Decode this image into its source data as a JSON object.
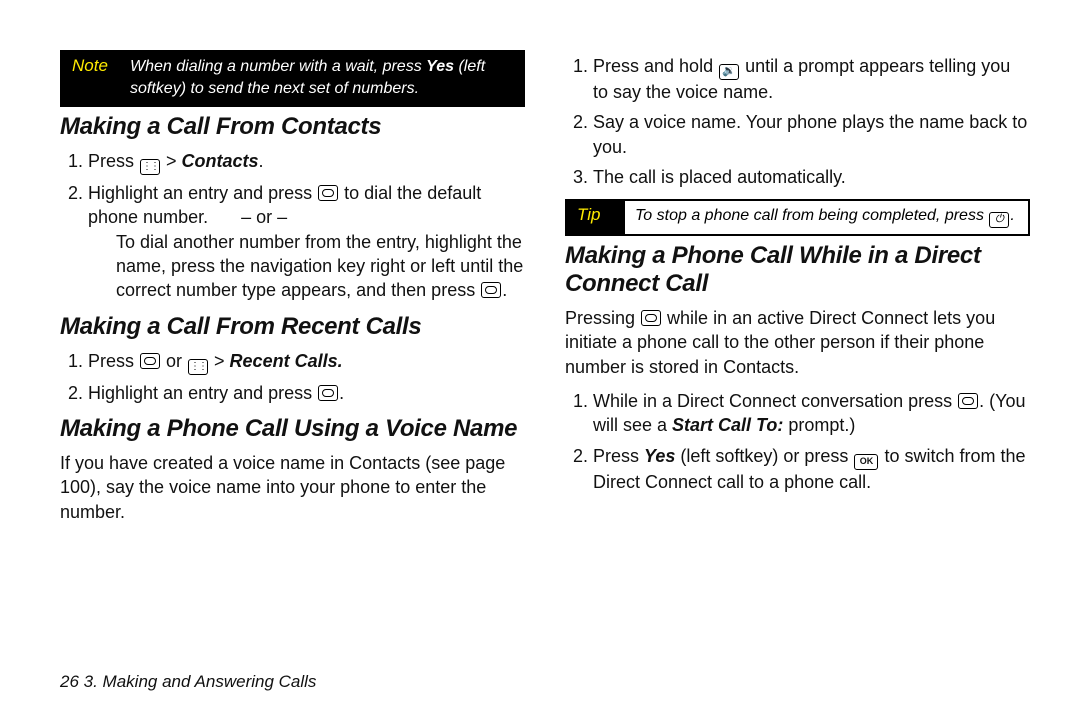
{
  "note": {
    "label": "Note",
    "body_pre": "When dialing a number with a wait, press ",
    "body_bold": "Yes",
    "body_post": " (left softkey) to send the next set of numbers."
  },
  "sectionA": {
    "heading": "Making a Call From Contacts",
    "step1_pre": "Press ",
    "step1_mid": " > ",
    "step1_bold": "Contacts",
    "step1_post": ".",
    "step2_pre": "Highlight an entry and press ",
    "step2_post": " to dial the default phone number.",
    "or": "– or –",
    "alt": "To dial another number from the entry, highlight the name, press the navigation key right or left until the correct number type appears, and then press ",
    "alt_post": "."
  },
  "sectionB": {
    "heading": "Making a Call From Recent Calls",
    "step1_pre": "Press ",
    "step1_or": " or ",
    "step1_mid": " > ",
    "step1_bold": "Recent Calls.",
    "step2_pre": "Highlight an entry and press ",
    "step2_post": "."
  },
  "sectionC": {
    "heading": "Making a Phone Call Using a Voice Name",
    "intro": "If you have created a voice name in Contacts (see page 100), say the voice name into your phone to enter the number."
  },
  "sectionC_steps": {
    "s1_pre": "Press and hold ",
    "s1_post": " until a prompt appears telling you to say the voice name.",
    "s2": "Say a voice name. Your phone plays the name back to you.",
    "s3": "The call is placed automatically."
  },
  "tip": {
    "label": "Tip",
    "body_pre": "To stop a phone call from being completed, press ",
    "body_post": "."
  },
  "sectionD": {
    "heading": "Making a Phone Call While in a Direct Connect Call",
    "intro_pre": "Pressing ",
    "intro_post": " while in an active Direct Connect lets you initiate a phone call to the other person if their phone number is stored in Contacts.",
    "s1_pre": "While in a Direct Connect conversation press ",
    "s1_mid": ". (You will see a ",
    "s1_bold": "Start Call To:",
    "s1_post": " prompt.)",
    "s2_pre": "Press ",
    "s2_yes": "Yes",
    "s2_mid": " (left softkey) or press ",
    "s2_post": "  to switch from the Direct Connect call to a phone call."
  },
  "footer": {
    "page": "26",
    "sep": "    ",
    "chapter": "3. Making and Answering Calls"
  }
}
